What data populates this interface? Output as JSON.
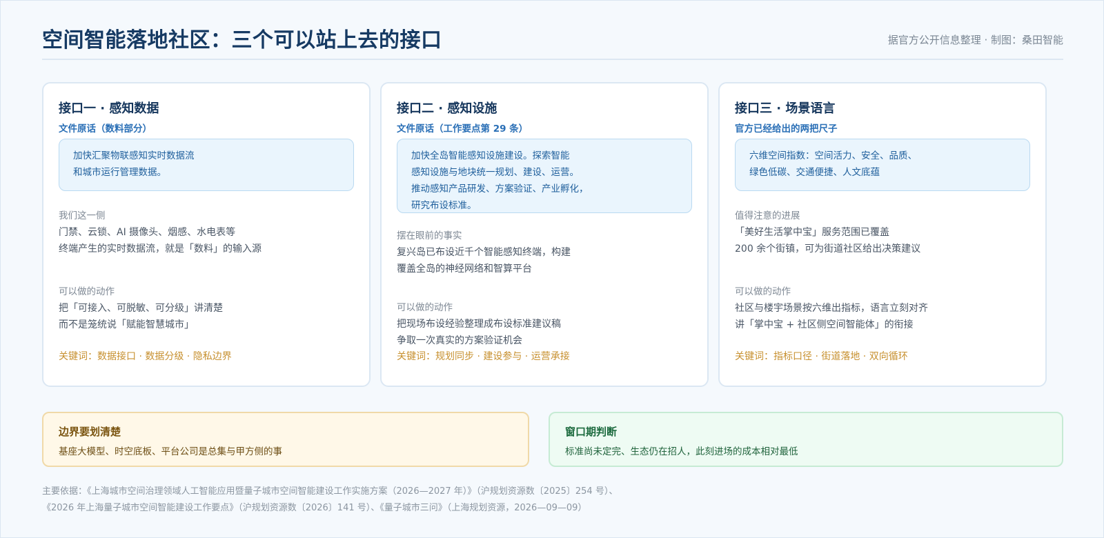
{
  "header": {
    "title": "空间智能落地社区：三个可以站上去的接口",
    "credit": "据官方公开信息整理 · 制图：桑田智能"
  },
  "cards": [
    {
      "title": "接口一 · 感知数据",
      "subtitle": "文件原话（数料部分）",
      "quote": [
        "加快汇聚物联感知实时数据流",
        "和城市运行管理数据。"
      ],
      "section1_label": "我们这一侧",
      "section1_body": [
        "门禁、云锁、AI 摄像头、烟感、水电表等",
        "终端产生的实时数据流，就是「数料」的输入源"
      ],
      "section2_label": "可以做的动作",
      "section2_body": [
        "把「可接入、可脱敏、可分级」讲清楚",
        "而不是笼统说「赋能智慧城市」"
      ],
      "keywords": "关键词：数据接口 · 数据分级 · 隐私边界"
    },
    {
      "title": "接口二 · 感知设施",
      "subtitle": "文件原话（工作要点第 29 条）",
      "quote": [
        "加快全岛智能感知设施建设。探索智能",
        "感知设施与地块统一规划、建设、运营。",
        "推动感知产品研发、方案验证、产业孵化，",
        "研究布设标准。"
      ],
      "section1_label": "摆在眼前的事实",
      "section1_body": [
        "复兴岛已布设近千个智能感知终端，构建",
        "覆盖全岛的神经网络和智算平台"
      ],
      "section2_label": "可以做的动作",
      "section2_body": [
        "把现场布设经验整理成布设标准建议稿",
        "争取一次真实的方案验证机会"
      ],
      "keywords": "关键词：规划同步 · 建设参与 · 运营承接"
    },
    {
      "title": "接口三 · 场景语言",
      "subtitle": "官方已经给出的两把尺子",
      "quote": [
        "六维空间指数：空间活力、安全、品质、",
        "绿色低碳、交通便捷、人文底蕴"
      ],
      "section1_label": "值得注意的进展",
      "section1_body": [
        "「美好生活掌中宝」服务范围已覆盖",
        "200 余个街镇，可为街道社区给出决策建议"
      ],
      "section2_label": "可以做的动作",
      "section2_body": [
        "社区与楼宇场景按六维出指标，语言立刻对齐",
        "讲「掌中宝 + 社区侧空间智能体」的衔接"
      ],
      "keywords": "关键词：指标口径 · 街道落地 · 双向循环"
    }
  ],
  "bottom": {
    "left": {
      "title": "边界要划清楚",
      "body": "基座大模型、时空底板、平台公司是总集与甲方侧的事"
    },
    "right": {
      "title": "窗口期判断",
      "body": "标准尚未定完、生态仍在招人，此刻进场的成本相对最低"
    }
  },
  "footnote": [
    "主要依据：《上海城市空间治理领域人工智能应用暨量子城市空间智能建设工作实施方案（2026—2027 年）》（沪规划资源数〔2025〕254 号）、",
    "《2026 年上海量子城市空间智能建设工作要点》（沪规划资源数〔2026〕141 号）、《量子城市三问》（上海规划资源，2026—09—09）"
  ]
}
